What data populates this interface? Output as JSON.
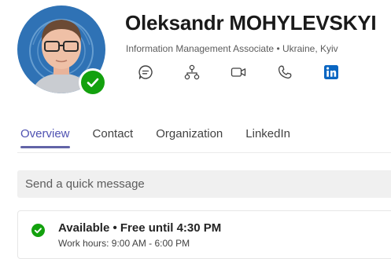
{
  "profile": {
    "name": "Oleksandr MOHYLEVSKYI",
    "subtitle": "Information Management Associate • Ukraine, Kyiv",
    "presence": "available"
  },
  "actions": [
    {
      "icon": "chat-icon"
    },
    {
      "icon": "org-chart-icon"
    },
    {
      "icon": "video-call-icon"
    },
    {
      "icon": "phone-icon"
    },
    {
      "icon": "linkedin-icon"
    }
  ],
  "tabs": [
    {
      "label": "Overview",
      "active": true
    },
    {
      "label": "Contact",
      "active": false
    },
    {
      "label": "Organization",
      "active": false
    },
    {
      "label": "LinkedIn",
      "active": false
    }
  ],
  "quick_message": {
    "placeholder": "Send a quick message"
  },
  "status": {
    "line": "Available • Free until 4:30 PM",
    "work_hours": "Work hours: 9:00 AM - 6:00 PM"
  },
  "colors": {
    "accent": "#6264a7",
    "available": "#13a10e",
    "linkedin": "#0a66c2"
  }
}
